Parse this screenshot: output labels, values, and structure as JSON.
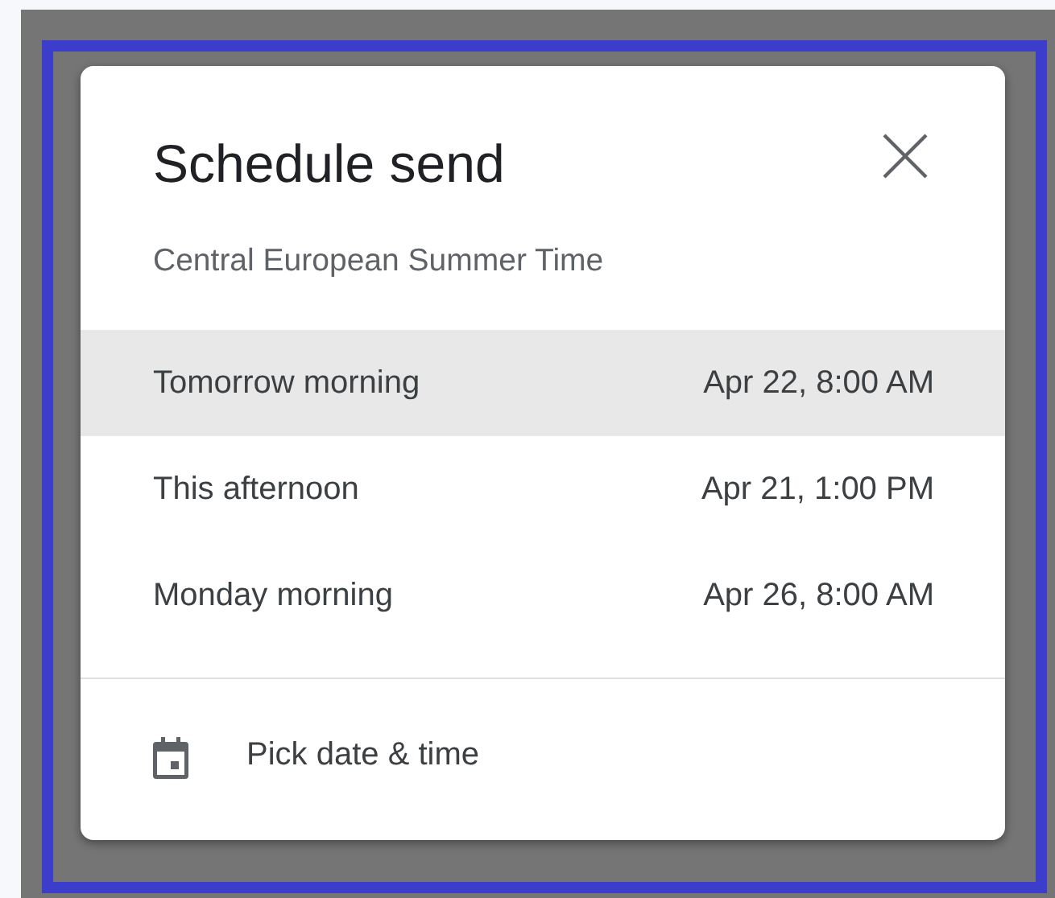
{
  "dialog": {
    "title": "Schedule send",
    "subtitle": "Central European Summer Time",
    "options": [
      {
        "label": "Tomorrow morning",
        "time": "Apr 22, 8:00 AM",
        "selected": true
      },
      {
        "label": "This afternoon",
        "time": "Apr 21, 1:00 PM",
        "selected": false
      },
      {
        "label": "Monday morning",
        "time": "Apr 26, 8:00 AM",
        "selected": false
      }
    ],
    "pick": {
      "label": "Pick date & time"
    }
  }
}
